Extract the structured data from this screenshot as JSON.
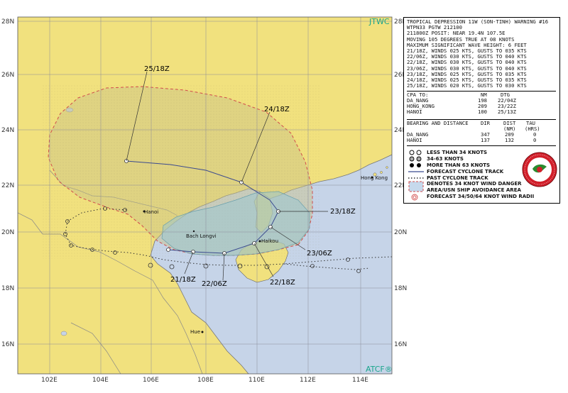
{
  "map": {
    "corner_top": "JTWC",
    "corner_bottom": "ATCF®",
    "lat_labels": [
      "28N",
      "26N",
      "24N",
      "22N",
      "20N",
      "18N",
      "16N"
    ],
    "lon_labels": [
      "102E",
      "104E",
      "106E",
      "108E",
      "110E",
      "112E",
      "114E"
    ],
    "cities": {
      "hanoi": "Hanoi",
      "hong_kong": "Hong Kong",
      "bach_long_vi": "Bach Longvi",
      "haikou": "Haikou",
      "hue": "Hue"
    },
    "track_times": [
      "25/18Z",
      "24/18Z",
      "23/18Z",
      "23/06Z",
      "22/18Z",
      "22/06Z",
      "21/18Z"
    ],
    "colors": {
      "land": "#f1e17e",
      "sea": "#c6d4e8",
      "danger_area": "#c9c387",
      "wind_radius": "#9ac6cf",
      "danger_outline": "#d24c4c",
      "track": "#3b4a8f"
    }
  },
  "warning": {
    "header_lines": [
      "TROPICAL DEPRESSION 11W (SON-TINH) WARNING #16",
      "WTPN33 PGTW 212100",
      "211800Z POSIT: NEAR 19.4N 107.5E",
      "MOVING 105 DEGREES TRUE AT 08 KNOTS",
      "MAXIMUM SIGNIFICANT WAVE HEIGHT: 6 FEET",
      "21/18Z, WINDS 025 KTS, GUSTS TO 035 KTS",
      "22/06Z, WINDS 030 KTS, GUSTS TO 040 KTS",
      "22/18Z, WINDS 030 KTS, GUSTS TO 040 KTS",
      "23/06Z, WINDS 030 KTS, GUSTS TO 040 KTS",
      "23/18Z, WINDS 025 KTS, GUSTS TO 035 KTS",
      "24/18Z, WINDS 025 KTS, GUSTS TO 035 KTS",
      "25/18Z, WINDS 020 KTS, GUSTS TO 030 KTS"
    ],
    "cpa": {
      "title": "CPA TO:",
      "nm_header": "NM",
      "dtg_header": "DTG",
      "rows": [
        {
          "place": "DA_NANG",
          "nm": "198",
          "dtg": "22/04Z"
        },
        {
          "place": "HONG_KONG",
          "nm": "209",
          "dtg": "23/22Z"
        },
        {
          "place": "HANOI",
          "nm": "100",
          "dtg": "25/13Z"
        }
      ]
    },
    "bearing": {
      "title": "BEARING AND DISTANCE",
      "dir_header": "DIR",
      "dist_header": "DIST",
      "tau_header": "TAU",
      "nm_unit": "(NM)",
      "hrs_unit": "(HRS)",
      "rows": [
        {
          "place": "DA_NANG",
          "dir": "347",
          "dist": "209",
          "tau": "0"
        },
        {
          "place": "HANOI",
          "dir": "137",
          "dist": "132",
          "tau": "0"
        }
      ]
    }
  },
  "legend": {
    "items": [
      "LESS THAN 34 KNOTS",
      "34-63 KNOTS",
      "MORE THAN 63 KNOTS",
      "FORECAST CYCLONE TRACK",
      "PAST CYCLONE TRACK",
      "DENOTES 34 KNOT WIND DANGER",
      "AREA/USN SHIP AVOIDANCE AREA",
      "FORECAST 34/50/64 KNOT WIND RADII"
    ],
    "icons": [
      "open-cyclone-icon",
      "half-filled-cyclone-icon",
      "filled-cyclone-icon",
      "solid-line-icon",
      "dotted-line-icon",
      "danger-area-swatch-icon",
      "danger-area-swatch-icon",
      "wind-radii-icon"
    ],
    "logo": "jtwc-logo-icon"
  }
}
